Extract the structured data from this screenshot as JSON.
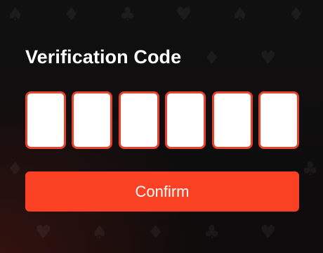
{
  "form": {
    "title": "Verification Code",
    "code_digits": [
      "",
      "",
      "",
      "",
      "",
      ""
    ],
    "confirm_label": "Confirm"
  },
  "background": {
    "pattern_icons": [
      "spade-icon",
      "club-icon",
      "diamond-icon",
      "heart-icon"
    ]
  },
  "colors": {
    "accent": "#fb4124",
    "box_border": "#e8412c",
    "background": "#0c0a0a",
    "title_text": "#ffffff"
  }
}
